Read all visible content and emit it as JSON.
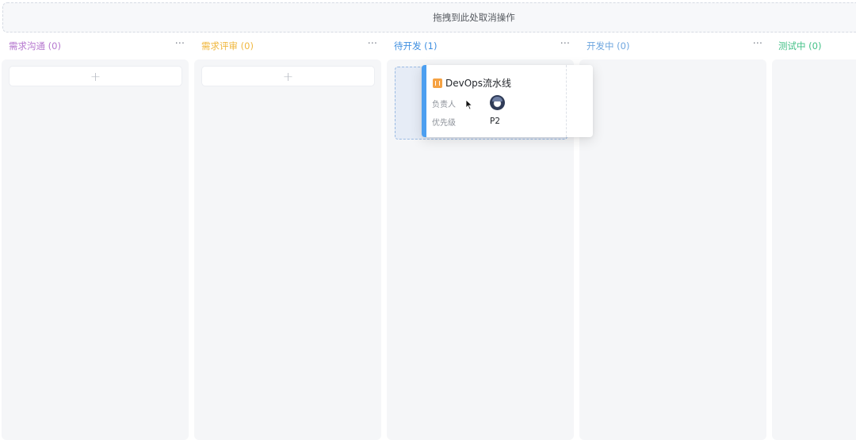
{
  "dropzone": {
    "text": "拖拽到此处取消操作"
  },
  "columns": [
    {
      "title": "需求沟通 (0)",
      "color": "#b678cf",
      "more": "···",
      "add": "+"
    },
    {
      "title": "需求评审 (0)",
      "color": "#f0b840",
      "more": "···",
      "add": "+"
    },
    {
      "title": "待开发 (1)",
      "color": "#3f8fe0",
      "more": "···"
    },
    {
      "title": "开发中 (0)",
      "color": "#6ea6df",
      "more": "···"
    },
    {
      "title": "测试中 (0)",
      "color": "#43c087"
    }
  ],
  "card": {
    "title": "DevOps流水线",
    "icon": "requirement-icon",
    "owner_label": "负责人",
    "priority_label": "优先级",
    "priority": "P2",
    "accent": "#4c9ff0"
  }
}
